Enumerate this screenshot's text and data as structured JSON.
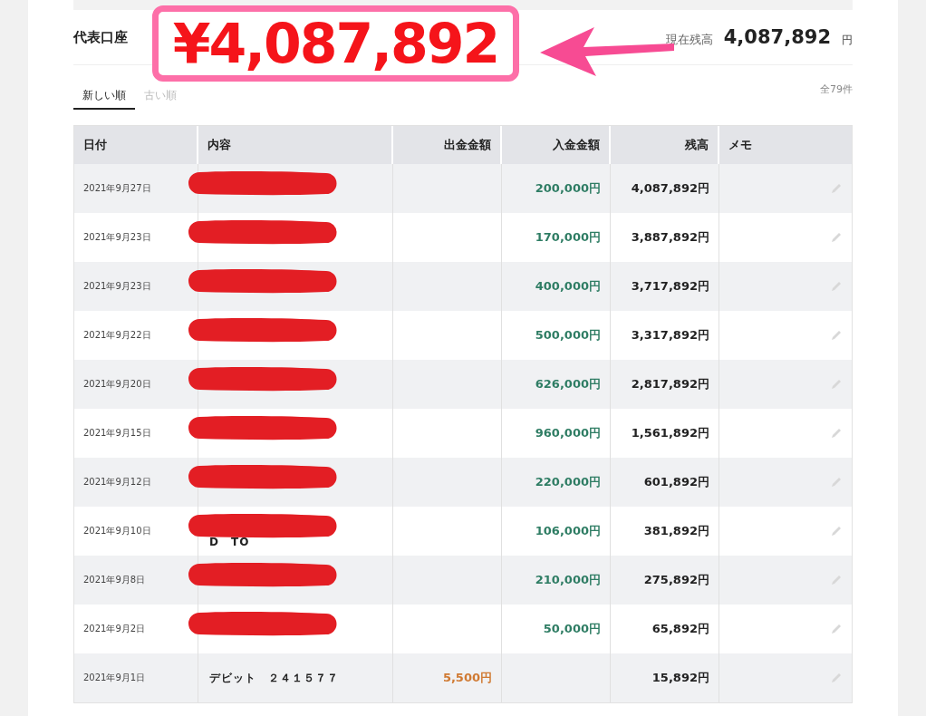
{
  "account": {
    "title": "代表口座",
    "balance_label": "現在残高",
    "balance": "4,087,892",
    "unit": "円"
  },
  "annotation": {
    "text": "¥4,087,892"
  },
  "tabs": [
    {
      "label": "新しい順",
      "selected": true
    },
    {
      "label": "古い順",
      "selected": false
    }
  ],
  "count": "全79件",
  "table": {
    "columns": [
      "日付",
      "内容",
      "出金金額",
      "入金金額",
      "残高",
      "メモ"
    ],
    "rows": [
      {
        "date": "2021年9月27日",
        "redacted": true,
        "withdrawal": "",
        "deposit": "200,000円",
        "balance": "4,087,892円"
      },
      {
        "date": "2021年9月23日",
        "redacted": true,
        "withdrawal": "",
        "deposit": "170,000円",
        "balance": "3,887,892円"
      },
      {
        "date": "2021年9月23日",
        "redacted": true,
        "withdrawal": "",
        "deposit": "400,000円",
        "balance": "3,717,892円"
      },
      {
        "date": "2021年9月22日",
        "redacted": true,
        "withdrawal": "",
        "deposit": "500,000円",
        "balance": "3,317,892円"
      },
      {
        "date": "2021年9月20日",
        "redacted": true,
        "withdrawal": "",
        "deposit": "626,000円",
        "balance": "2,817,892円"
      },
      {
        "date": "2021年9月15日",
        "redacted": true,
        "withdrawal": "",
        "deposit": "960,000円",
        "balance": "1,561,892円"
      },
      {
        "date": "2021年9月12日",
        "redacted": true,
        "withdrawal": "",
        "deposit": "220,000円",
        "balance": "601,892円"
      },
      {
        "date": "2021年9月10日",
        "redacted": true,
        "description": "D　TO",
        "withdrawal": "",
        "deposit": "106,000円",
        "balance": "381,892円"
      },
      {
        "date": "2021年9月8日",
        "redacted": true,
        "withdrawal": "",
        "deposit": "210,000円",
        "balance": "275,892円"
      },
      {
        "date": "2021年9月2日",
        "redacted": true,
        "withdrawal": "",
        "deposit": "50,000円",
        "balance": "65,892円"
      },
      {
        "date": "2021年9月1日",
        "redacted": false,
        "description": "デビット　２４１５７７",
        "withdrawal": "5,500円",
        "deposit": "",
        "balance": "15,892円"
      }
    ]
  }
}
